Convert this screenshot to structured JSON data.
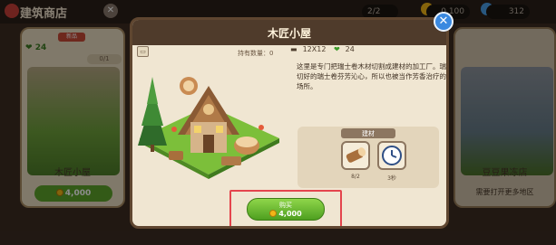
{
  "shop": {
    "title": "建筑商店",
    "resources": [
      "2/2",
      "0,100",
      "312"
    ]
  },
  "cards": [
    {
      "hearts": "24",
      "badge": "新品",
      "count": "0/1",
      "name": "木匠小屋",
      "price": "4,000"
    },
    {
      "name": "豆豆果冻店",
      "note": "需要打开更多地区"
    }
  ],
  "modal": {
    "title": "木匠小屋",
    "owned_label": "持有数量：0",
    "size": "12X12",
    "hearts": "24",
    "description": "这里是专门把瑞士卷木材切割成建材的加工厂。瑞切好的瑞士卷芬芳沁心，所以也被当作芳香治疗的场所。",
    "materials_label": "建材",
    "materials": [
      {
        "icon": "log-icon",
        "count": "8/2"
      },
      {
        "icon": "clock-icon",
        "count": "3秒"
      }
    ],
    "buy": {
      "label": "购买",
      "price": "4,000"
    },
    "close": "✕"
  },
  "colors": {
    "accent_green": "#5ea42a",
    "close_blue": "#3a89e0",
    "highlight_red": "#e4454d",
    "panel_brown": "#4f3b2b"
  }
}
